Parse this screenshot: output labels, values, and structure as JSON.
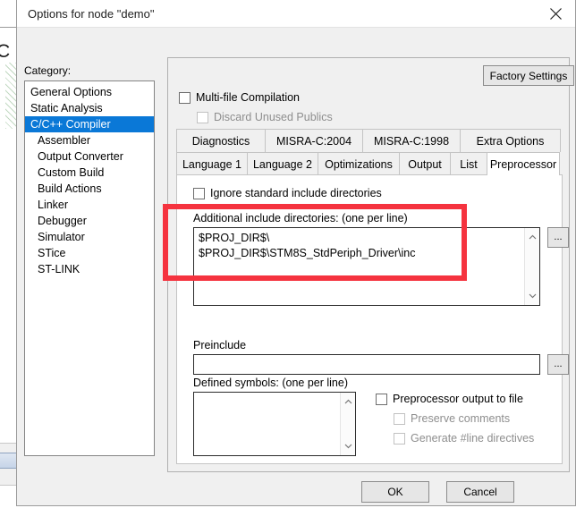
{
  "window": {
    "title": "Options for node \"demo\"",
    "close_icon": "close-icon"
  },
  "category": {
    "label": "Category:",
    "items": [
      {
        "label": "General Options",
        "indent": false,
        "selected": false
      },
      {
        "label": "Static Analysis",
        "indent": false,
        "selected": false
      },
      {
        "label": "C/C++ Compiler",
        "indent": false,
        "selected": true
      },
      {
        "label": "Assembler",
        "indent": true,
        "selected": false
      },
      {
        "label": "Output Converter",
        "indent": true,
        "selected": false
      },
      {
        "label": "Custom Build",
        "indent": true,
        "selected": false
      },
      {
        "label": "Build Actions",
        "indent": true,
        "selected": false
      },
      {
        "label": "Linker",
        "indent": true,
        "selected": false
      },
      {
        "label": "Debugger",
        "indent": true,
        "selected": false
      },
      {
        "label": "Simulator",
        "indent": true,
        "selected": false
      },
      {
        "label": "STice",
        "indent": true,
        "selected": false
      },
      {
        "label": "ST-LINK",
        "indent": true,
        "selected": false
      }
    ],
    "selected_index": 2
  },
  "panel": {
    "factory_settings_label": "Factory Settings",
    "multi_file_compilation": {
      "label": "Multi-file Compilation",
      "checked": false,
      "disabled": false
    },
    "discard_unused_publics": {
      "label": "Discard Unused Publics",
      "checked": false,
      "disabled": true
    }
  },
  "tabs": {
    "top_row": [
      {
        "label": "Diagnostics",
        "active": false
      },
      {
        "label": "MISRA-C:2004",
        "active": false
      },
      {
        "label": "MISRA-C:1998",
        "active": false
      },
      {
        "label": "Extra Options",
        "active": false
      }
    ],
    "bottom_row": [
      {
        "label": "Language 1",
        "active": false
      },
      {
        "label": "Language 2",
        "active": false
      },
      {
        "label": "Optimizations",
        "active": false
      },
      {
        "label": "Output",
        "active": false
      },
      {
        "label": "List",
        "active": false
      },
      {
        "label": "Preprocessor",
        "active": true
      }
    ],
    "active_tab": "Preprocessor"
  },
  "preprocessor": {
    "ignore_standard_include": {
      "label": "Ignore standard include directories",
      "checked": false,
      "disabled": false
    },
    "additional_include": {
      "label": "Additional include directories: (one per line)",
      "value": "$PROJ_DIR$\\\n$PROJ_DIR$\\STM8S_StdPeriph_Driver\\inc",
      "lines": [
        "$PROJ_DIR$\\",
        "$PROJ_DIR$\\STM8S_StdPeriph_Driver\\inc"
      ],
      "browse_label": "...",
      "scroll_up_icon": "chevron-up-icon",
      "scroll_down_icon": "chevron-down-icon"
    },
    "preinclude": {
      "label": "Preinclude",
      "value": "",
      "placeholder": "",
      "browse_label": "..."
    },
    "defined_symbols": {
      "label": "Defined symbols: (one per line)",
      "value": "",
      "scroll_up_icon": "chevron-up-icon",
      "scroll_down_icon": "chevron-down-icon"
    },
    "preprocessor_output_to_file": {
      "label": "Preprocessor output to file",
      "checked": false,
      "disabled": false
    },
    "preserve_comments": {
      "label": "Preserve comments",
      "checked": false,
      "disabled": true
    },
    "generate_line_directives": {
      "label": "Generate #line directives",
      "checked": false,
      "disabled": true
    }
  },
  "footer": {
    "ok_label": "OK",
    "cancel_label": "Cancel"
  },
  "annotation": {
    "color": "#f5333f",
    "shape": "rectangle",
    "targets": "Additional include directories field"
  },
  "background": {
    "partial_letter": "C"
  }
}
